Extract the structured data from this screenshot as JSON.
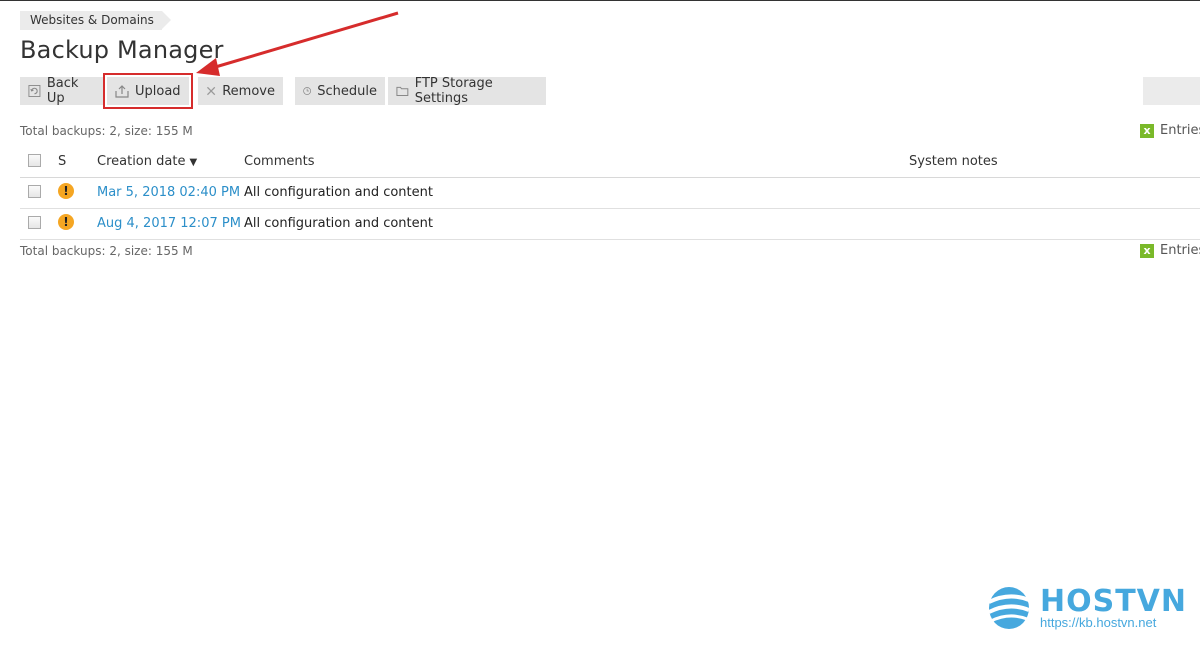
{
  "breadcrumb": [
    "Websites & Domains"
  ],
  "page": {
    "title": "Backup Manager"
  },
  "toolbar": {
    "backup_label": "Back Up",
    "upload_label": "Upload",
    "remove_label": "Remove",
    "schedule_label": "Schedule",
    "ftp_label": "FTP Storage Settings"
  },
  "summary": "Total backups: 2, size: 155 M",
  "export_label": "Entries",
  "table": {
    "headers": {
      "s": "S",
      "date": "Creation date",
      "comments": "Comments",
      "notes": "System notes"
    },
    "rows": [
      {
        "date": "Mar 5, 2018 02:40 PM",
        "comment": "All configuration and content",
        "notes": ""
      },
      {
        "date": "Aug 4, 2017 12:07 PM",
        "comment": "All configuration and content",
        "notes": ""
      }
    ]
  },
  "logo": {
    "name": "HOSTVN",
    "url": "https://kb.hostvn.net"
  },
  "colors": {
    "link": "#2c8fc9",
    "highlight": "#d62c2c",
    "warning": "#f5a623",
    "export": "#7ab929",
    "brand": "#46a8de"
  }
}
